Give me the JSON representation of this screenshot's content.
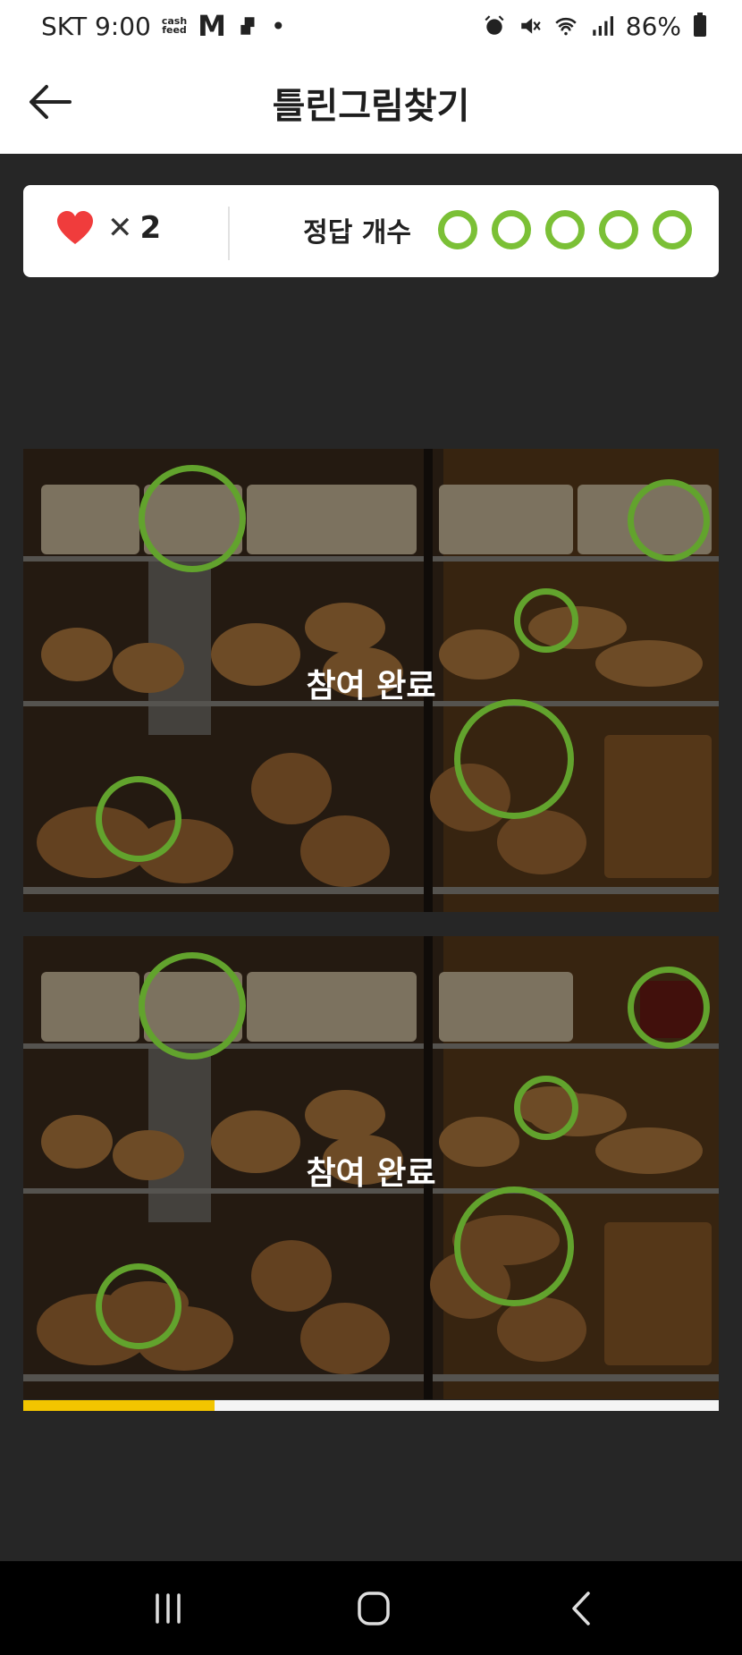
{
  "status_bar": {
    "carrier_time": "SKT 9:00",
    "cashfeed": "cash\nfeed",
    "m_logo": "M",
    "dot": "•",
    "battery_text": "86%",
    "icons": [
      "alarm-icon",
      "mute-icon",
      "wifi-icon",
      "signal-icon",
      "battery-icon"
    ]
  },
  "header": {
    "title": "틀린그림찾기",
    "back_icon": "arrow-left-icon"
  },
  "scorecard": {
    "lives_icon": "heart-icon",
    "times_symbol": "✕",
    "lives_count": "2",
    "answers_label": "정답 개수",
    "answers_total": 5,
    "answers_found": 5,
    "ring_color": "#7bc036"
  },
  "puzzle": {
    "completed_label": "참여 완료",
    "differences_found": 5,
    "ring_color": "#62a32d"
  },
  "progress": {
    "fraction": 0.275,
    "fill_color": "#f2c500"
  },
  "navbar": {
    "icons": [
      "recent-apps-icon",
      "home-icon",
      "back-nav-icon"
    ]
  }
}
